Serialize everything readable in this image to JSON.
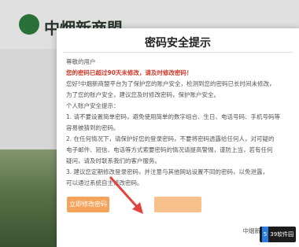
{
  "background": {
    "logo_text": "中烟新商盟"
  },
  "dialog": {
    "title": "密码安全提示",
    "greeting": "尊敬的用户",
    "warning": "您的密码已超过90天未修改，请及时修改密码！",
    "lines": [
      "    您好!中烟新商盟平台为了保护您的账户安全，检测到您的密码已长时间未修改，",
      "为了您的账户安全，建议您及时修改密码，保护账户安全。",
      "    个人账户安全提示：",
      "    1. 请不要设置简单密码，避免使用简单的数字组合、生日、电话号码、手机号码等",
      "容易被猜到的密码。",
      "    2. 在任何情况下，请保护好您的登录密码，不要将密码透露给任何人，对可疑的",
      "电子邮件、短信、电话等方式索要密码的情况请提高警惕，谨防上当，若有任何",
      "疑问，请及时联系我们的客户服务。",
      "    3. 建议您定期修改登录密码，并注意与其他网站设置不同的密码，以免泄露，",
      "可以通过系统自主修改密码。"
    ],
    "signature": "中烟新商盟门户网站",
    "update_button": "立即修改密码"
  },
  "watermark": {
    "badge": "5",
    "text": "39软件园"
  }
}
